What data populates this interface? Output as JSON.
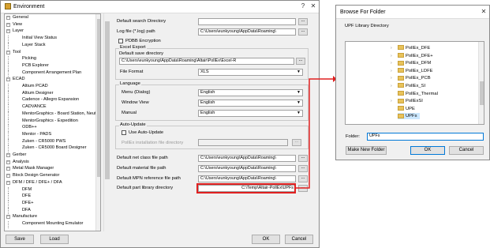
{
  "env": {
    "title": "Environment",
    "tree": [
      {
        "label": "General",
        "level": 0,
        "selected": false
      },
      {
        "label": "View",
        "level": 0
      },
      {
        "label": "Layer",
        "level": 0
      },
      {
        "label": "Initial View Status",
        "level": 1
      },
      {
        "label": "Layer Stack",
        "level": 1
      },
      {
        "label": "Tool",
        "level": 0
      },
      {
        "label": "Picking",
        "level": 1
      },
      {
        "label": "PCB Explorer",
        "level": 1
      },
      {
        "label": "Component Arrangement Plan",
        "level": 1
      },
      {
        "label": "ECAD",
        "level": 0
      },
      {
        "label": "Altium PCAD",
        "level": 1
      },
      {
        "label": "Altium Designer",
        "level": 1
      },
      {
        "label": "Cadence - Allegro Expansion",
        "level": 1
      },
      {
        "label": "CADVANCE",
        "level": 1
      },
      {
        "label": "MentorGraphics - Board Station, Neutral",
        "level": 1
      },
      {
        "label": "MentorGraphics - Expedition",
        "level": 1
      },
      {
        "label": "ODB++",
        "level": 1
      },
      {
        "label": "Mentor - PADS",
        "level": 1
      },
      {
        "label": "Zuken - CR5000 PWS",
        "level": 1
      },
      {
        "label": "Zuken - CR5000 Board Designer",
        "level": 1
      },
      {
        "label": "Gerber",
        "level": 0
      },
      {
        "label": "Analysis",
        "level": 0
      },
      {
        "label": "Metal Mask Manager",
        "level": 0
      },
      {
        "label": "Block Design Generator",
        "level": 0
      },
      {
        "label": "DFM / DFE / DFE+ / DFA",
        "level": 0
      },
      {
        "label": "DFM",
        "level": 1
      },
      {
        "label": "DFE",
        "level": 1
      },
      {
        "label": "DFE+",
        "level": 1
      },
      {
        "label": "DFA",
        "level": 1
      },
      {
        "label": "Manufacture",
        "level": 0
      },
      {
        "label": "Component Mounting Emulator",
        "level": 1
      }
    ],
    "settings": {
      "default_search_dir_label": "Default search Directory",
      "default_search_dir_value": "",
      "log_file_label": "Log file (*.log) path",
      "log_file_value": "C:\\Users\\eunkyoung\\AppData\\Roaming\\",
      "pdbb_label": "PDBB Encryption",
      "excel_export_title": "Excel Export",
      "default_save_dir_label": "Default save directory",
      "default_save_dir_value": "C:\\Users\\eunkyoung\\AppData\\Roaming\\Altair\\PollEx\\Excel-R",
      "file_format_label": "File Format",
      "file_format_value": "XLS",
      "language_title": "Language",
      "menu_label": "Menu (Dialog)",
      "menu_value": "English",
      "window_view_label": "Window View",
      "window_view_value": "English",
      "manual_label": "Manual",
      "manual_value": "English",
      "auto_update_title": "Auto-Update",
      "use_auto_update_label": "Use Auto-Update",
      "install_dir_label": "PollEx installation file directory",
      "install_dir_value": "",
      "net_class_label": "Default net class file path",
      "net_class_value": "C:\\Users\\eunkyoung\\AppData\\Roaming\\",
      "material_label": "Default material file path",
      "material_value": "C:\\Users\\eunkyoung\\AppData\\Roaming\\",
      "mpn_label": "Default MPN reference file path",
      "mpn_value": "C:\\Users\\eunkyoung\\AppData\\Roaming\\",
      "part_lib_label": "Default part library directory",
      "part_lib_value": "C:\\Temp\\Altair-PollEx\\UPFs",
      "dots": "..."
    },
    "buttons": {
      "save": "Save",
      "load": "Load",
      "ok": "OK",
      "cancel": "Cancel"
    }
  },
  "browse": {
    "title": "Browse For Folder",
    "subtitle": "UPF Library Directory",
    "folders": [
      {
        "label": "PollEx_DFE",
        "expandable": true
      },
      {
        "label": "PollEx_DFE+",
        "expandable": true
      },
      {
        "label": "PollEx_DFM",
        "expandable": true
      },
      {
        "label": "PollEx_LDFE",
        "expandable": true
      },
      {
        "label": "PollEx_PCB",
        "expandable": true
      },
      {
        "label": "PollEx_SI",
        "expandable": true
      },
      {
        "label": "PollEx_Thermal",
        "expandable": false
      },
      {
        "label": "PollExSI",
        "expandable": true
      },
      {
        "label": "UPE",
        "expandable": false
      },
      {
        "label": "UPFs",
        "expandable": false,
        "selected": true
      }
    ],
    "folder_label": "Folder:",
    "folder_value": "UPFs",
    "make_new_folder": "Make New Folder",
    "ok": "OK",
    "cancel": "Cancel"
  },
  "colors": {
    "highlight": "#cce8ff",
    "arrow": "#e02020",
    "default_border": "#0078d7"
  }
}
